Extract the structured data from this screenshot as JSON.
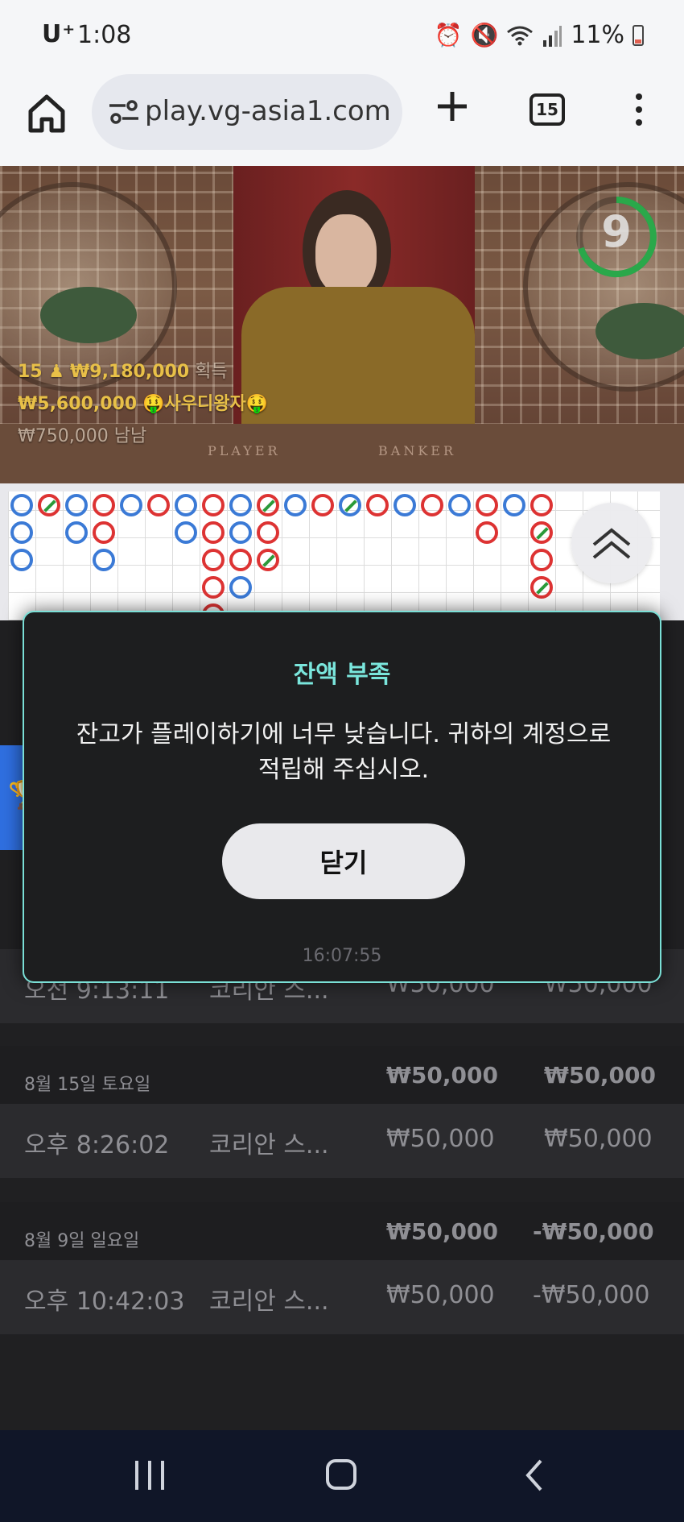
{
  "status_bar": {
    "carrier": "U⁺",
    "time": "1:08",
    "battery": "11%",
    "icons": [
      "alarm-icon",
      "mute-icon",
      "wifi-icon",
      "signal-icon",
      "battery-icon"
    ]
  },
  "browser": {
    "url": "play.vg-asia1.com",
    "tab_count": "15",
    "icons": [
      "home-icon",
      "site-settings-icon",
      "new-tab-icon",
      "tab-switcher-icon",
      "more-menu-icon"
    ]
  },
  "live_video": {
    "timer": "9",
    "table_labels": {
      "player": "PLAYER",
      "banker": "BANKER"
    },
    "winners": [
      {
        "prefix": "15 ♟",
        "amount": "₩9,180,000",
        "suffix": "획득"
      },
      {
        "amount": "₩5,600,000",
        "name": "🤑사우디왕자🤑"
      },
      {
        "amount": "₩750,000",
        "name": "남남"
      }
    ]
  },
  "history": {
    "groups": [
      {
        "date": "",
        "rows": [
          {
            "time": "오전 9:13:11",
            "game": "코리안 스...",
            "bet": "₩50,000",
            "result": "₩50,000"
          }
        ]
      },
      {
        "date": "8월 15일 토요일",
        "bet_total": "₩50,000",
        "result_total": "₩50,000",
        "rows": [
          {
            "time": "오후 8:26:02",
            "game": "코리안 스...",
            "bet": "₩50,000",
            "result": "₩50,000"
          }
        ]
      },
      {
        "date": "8월 9일 일요일",
        "bet_total": "₩50,000",
        "result_total": "-₩50,000",
        "rows": [
          {
            "time": "오후 10:42:03",
            "game": "코리안 스...",
            "bet": "₩50,000",
            "result": "-₩50,000"
          }
        ]
      }
    ]
  },
  "modal": {
    "title": "잔액 부족",
    "message": "잔고가 플레이하기에 너무 낮습니다. 귀하의 계정으로 적립해 주십시오.",
    "close_label": "닫기",
    "timestamp": "16:07:55"
  },
  "colors": {
    "modal_border": "#7adfd6",
    "modal_title": "#7ae6dc",
    "player_blue": "#3b7ad6",
    "banker_red": "#dd3333",
    "tie_green": "#2a9a3a",
    "timer_green": "#2aa84a"
  }
}
